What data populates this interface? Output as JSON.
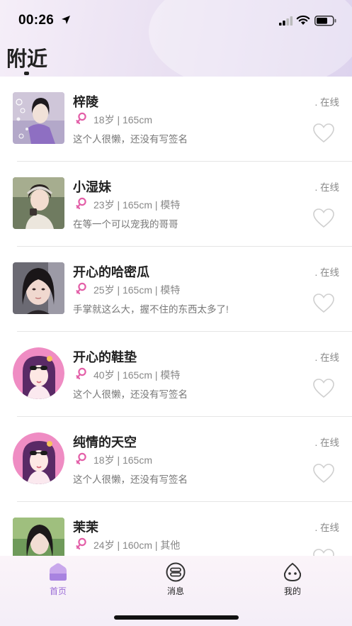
{
  "status_bar": {
    "time": "00:26"
  },
  "header": {
    "title": "附近"
  },
  "users": [
    {
      "name": "梓陵",
      "info": "18岁 | 165cm",
      "bio": "这个人很懒，还没有写签名",
      "status": ". 在线",
      "avatar": "photo-girl-1"
    },
    {
      "name": "小湿妹",
      "info": "23岁 | 165cm | 模特",
      "bio": "在等一个可以宠我的哥哥",
      "status": ". 在线",
      "avatar": "photo-girl-2"
    },
    {
      "name": "开心的哈密瓜",
      "info": "25岁 | 165cm | 模特",
      "bio": "手掌就这么大，握不住的东西太多了!",
      "status": ". 在线",
      "avatar": "photo-girl-3"
    },
    {
      "name": "开心的鞋垫",
      "info": "40岁 | 165cm | 模特",
      "bio": "这个人很懒，还没有写签名",
      "status": ". 在线",
      "avatar": "cartoon-default"
    },
    {
      "name": "纯情的天空",
      "info": "18岁 | 165cm",
      "bio": "这个人很懒，还没有写签名",
      "status": ". 在线",
      "avatar": "cartoon-default"
    },
    {
      "name": "茉茉",
      "info": "24岁 | 160cm | 其他",
      "bio": "",
      "status": ". 在线",
      "avatar": "photo-girl-4"
    }
  ],
  "tabs": [
    {
      "label": "首页",
      "icon": "home-icon",
      "active": true
    },
    {
      "label": "消息",
      "icon": "message-icon",
      "active": false
    },
    {
      "label": "我的",
      "icon": "profile-icon",
      "active": false
    }
  ],
  "colors": {
    "accent": "#9a6bd6",
    "female": "#e35fa8"
  }
}
